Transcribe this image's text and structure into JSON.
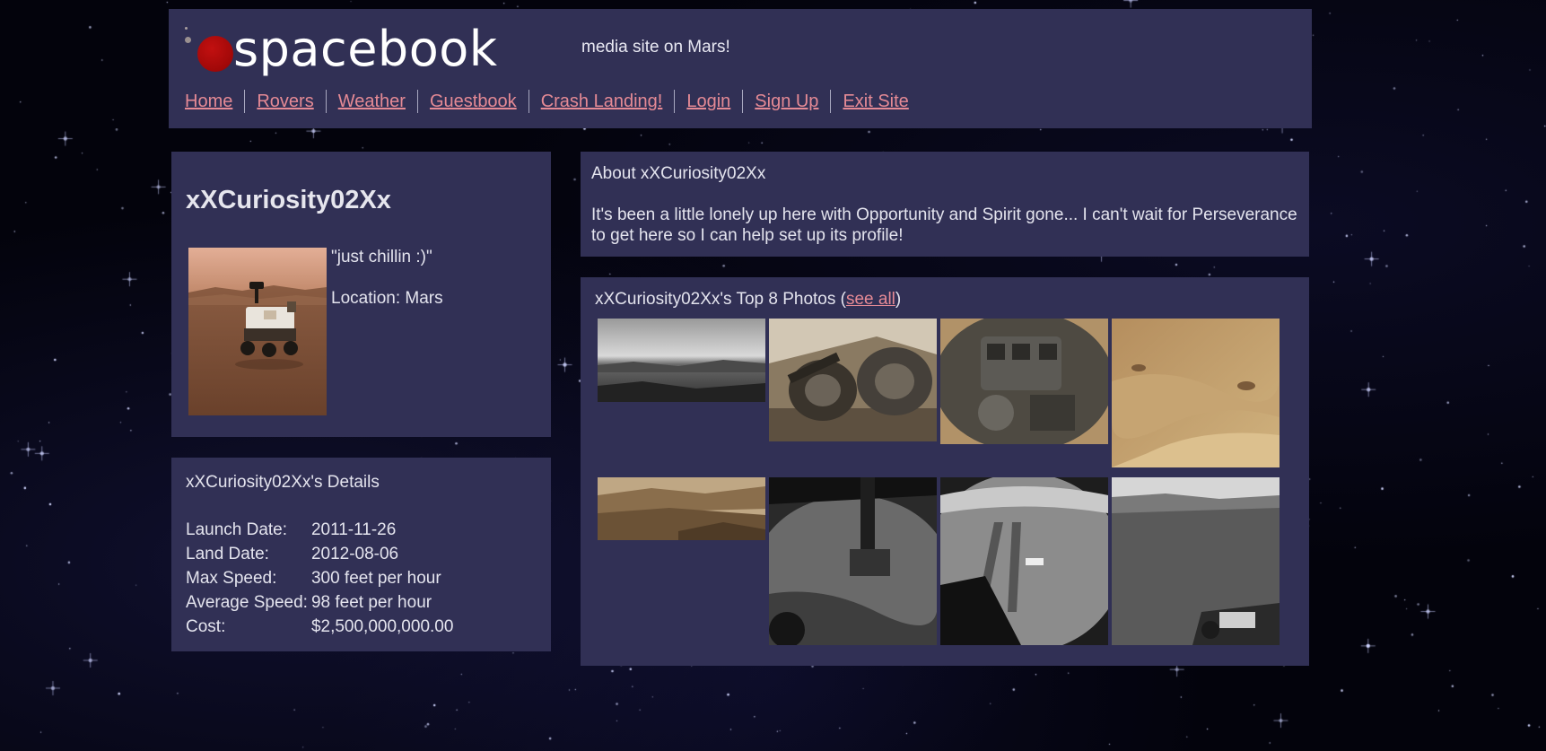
{
  "site": {
    "logo_text": "spacebook",
    "tagline_visible": "media site on Mars!"
  },
  "nav": [
    "Home",
    "Rovers",
    "Weather",
    "Guestbook",
    "Crash Landing!",
    "Login",
    "Sign Up",
    "Exit Site"
  ],
  "profile": {
    "username": "xXCuriosity02Xx",
    "status": "\"just chillin :)\"",
    "location": "Location: Mars"
  },
  "details": {
    "title": "xXCuriosity02Xx's Details",
    "rows": [
      {
        "key": "Launch Date:",
        "value": "2011-11-26"
      },
      {
        "key": "Land Date:",
        "value": "2012-08-06"
      },
      {
        "key": "Max Speed:",
        "value": "300 feet per hour"
      },
      {
        "key": "Average Speed:",
        "value": "98 feet per hour"
      },
      {
        "key": "Cost:",
        "value": "$2,500,000,000.00"
      }
    ]
  },
  "about": {
    "title": "About xXCuriosity02Xx",
    "text": "It's been a little lonely up here with Opportunity and Spirit gone... I can't wait for Perseverance to get here so I can help set up its profile!"
  },
  "photos": {
    "title_prefix": "xXCuriosity02Xx's Top 8 Photos (",
    "see_all": "see all",
    "title_suffix": ")"
  },
  "colors": {
    "panel": "#313055",
    "link": "#e58a95",
    "text": "#e4e4ee",
    "logo_dot": "#b00c0c"
  }
}
